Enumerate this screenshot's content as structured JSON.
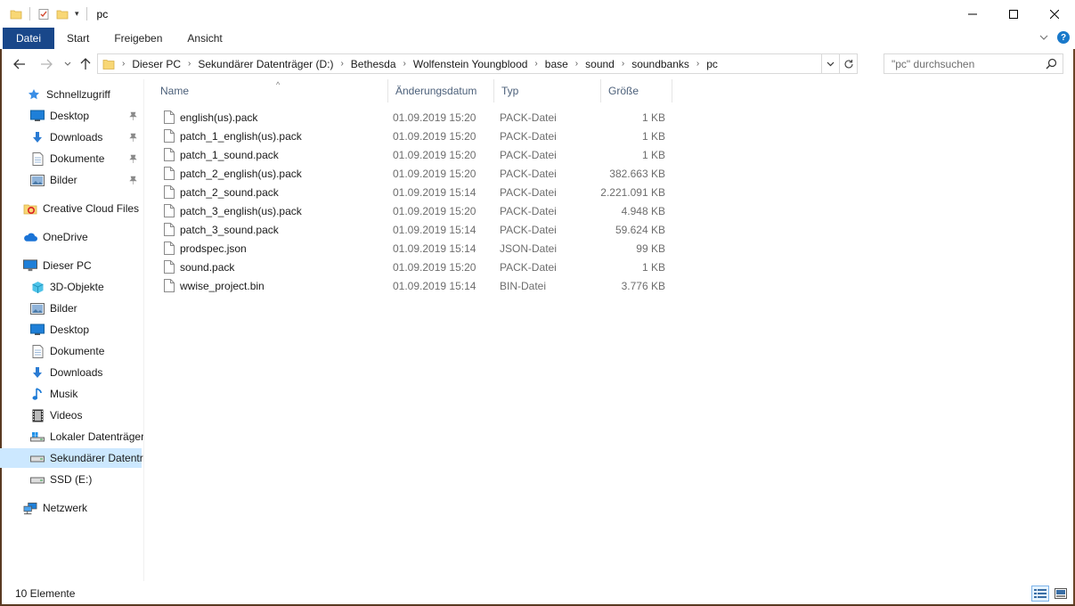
{
  "window": {
    "title": "pc",
    "minimize_icon": "minimize-icon",
    "maximize_icon": "maximize-icon",
    "close_icon": "close-icon"
  },
  "ribbon": {
    "tabs": [
      "Datei",
      "Start",
      "Freigeben",
      "Ansicht"
    ],
    "active_color": "#19478a"
  },
  "address": {
    "crumbs": [
      "Dieser PC",
      "Sekundärer Datenträger (D:)",
      "Bethesda",
      "Wolfenstein Youngblood",
      "base",
      "sound",
      "soundbanks",
      "pc"
    ]
  },
  "search": {
    "placeholder": "\"pc\" durchsuchen"
  },
  "sidebar": {
    "items": [
      {
        "label": "Schnellzugriff",
        "icon": "star-icon",
        "pinned": false
      },
      {
        "label": "Desktop",
        "icon": "desktop-icon",
        "pinned": true
      },
      {
        "label": "Downloads",
        "icon": "download-icon",
        "pinned": true
      },
      {
        "label": "Dokumente",
        "icon": "document-icon",
        "pinned": true
      },
      {
        "label": "Bilder",
        "icon": "pictures-icon",
        "pinned": true
      },
      {
        "label": "Creative Cloud Files",
        "icon": "creative-cloud-icon",
        "pinned": false
      },
      {
        "label": "OneDrive",
        "icon": "cloud-icon",
        "pinned": false
      },
      {
        "label": "Dieser PC",
        "icon": "computer-icon",
        "pinned": false
      },
      {
        "label": "3D-Objekte",
        "icon": "cube-icon",
        "pinned": false
      },
      {
        "label": "Bilder",
        "icon": "pictures-icon",
        "pinned": false
      },
      {
        "label": "Desktop",
        "icon": "desktop-icon",
        "pinned": false
      },
      {
        "label": "Dokumente",
        "icon": "document-icon",
        "pinned": false
      },
      {
        "label": "Downloads",
        "icon": "download-icon",
        "pinned": false
      },
      {
        "label": "Musik",
        "icon": "music-icon",
        "pinned": false
      },
      {
        "label": "Videos",
        "icon": "video-icon",
        "pinned": false
      },
      {
        "label": "Lokaler Datenträger",
        "icon": "system-drive-icon",
        "pinned": false
      },
      {
        "label": "Sekundärer Datenträ",
        "icon": "drive-icon",
        "pinned": false,
        "selected": true
      },
      {
        "label": "SSD (E:)",
        "icon": "drive-icon",
        "pinned": false
      },
      {
        "label": "Netzwerk",
        "icon": "network-icon",
        "pinned": false
      }
    ]
  },
  "columns": {
    "name": "Name",
    "date": "Änderungsdatum",
    "type": "Typ",
    "size": "Größe"
  },
  "files": [
    {
      "name": "english(us).pack",
      "date": "01.09.2019 15:20",
      "type": "PACK-Datei",
      "size": "1 KB"
    },
    {
      "name": "patch_1_english(us).pack",
      "date": "01.09.2019 15:20",
      "type": "PACK-Datei",
      "size": "1 KB"
    },
    {
      "name": "patch_1_sound.pack",
      "date": "01.09.2019 15:20",
      "type": "PACK-Datei",
      "size": "1 KB"
    },
    {
      "name": "patch_2_english(us).pack",
      "date": "01.09.2019 15:20",
      "type": "PACK-Datei",
      "size": "382.663 KB"
    },
    {
      "name": "patch_2_sound.pack",
      "date": "01.09.2019 15:14",
      "type": "PACK-Datei",
      "size": "2.221.091 KB"
    },
    {
      "name": "patch_3_english(us).pack",
      "date": "01.09.2019 15:20",
      "type": "PACK-Datei",
      "size": "4.948 KB"
    },
    {
      "name": "patch_3_sound.pack",
      "date": "01.09.2019 15:14",
      "type": "PACK-Datei",
      "size": "59.624 KB"
    },
    {
      "name": "prodspec.json",
      "date": "01.09.2019 15:14",
      "type": "JSON-Datei",
      "size": "99 KB"
    },
    {
      "name": "sound.pack",
      "date": "01.09.2019 15:20",
      "type": "PACK-Datei",
      "size": "1 KB"
    },
    {
      "name": "wwise_project.bin",
      "date": "01.09.2019 15:14",
      "type": "BIN-Datei",
      "size": "3.776 KB"
    }
  ],
  "status": {
    "count": "10 Elemente"
  }
}
